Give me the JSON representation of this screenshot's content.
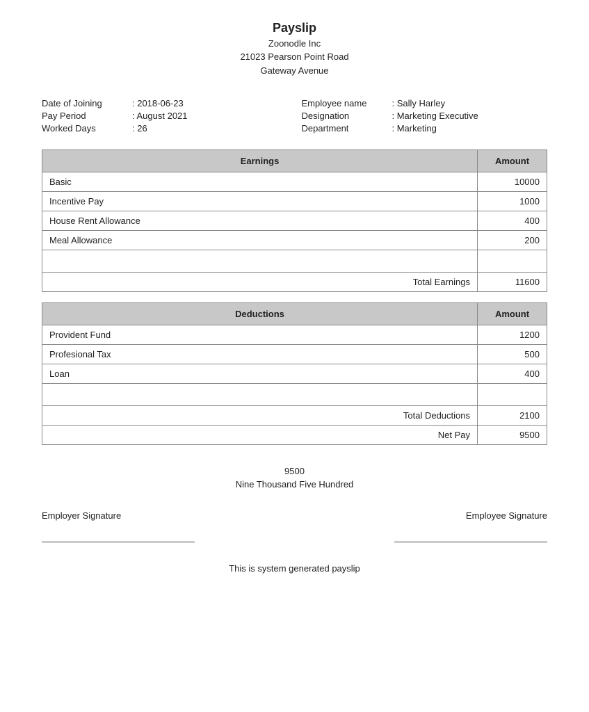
{
  "header": {
    "title": "Payslip",
    "company": "Zoonodle Inc",
    "address_line1": "21023 Pearson Point Road",
    "address_line2": "Gateway Avenue"
  },
  "employee_info": {
    "left": [
      {
        "label": "Date of Joining",
        "colon": ": 2018-06-23"
      },
      {
        "label": "Pay Period",
        "colon": ": August 2021"
      },
      {
        "label": "Worked Days",
        "colon": ": 26"
      }
    ],
    "right": [
      {
        "label": "Employee name",
        "colon": ": Sally Harley"
      },
      {
        "label": "Designation",
        "colon": ": Marketing Executive"
      },
      {
        "label": "Department",
        "colon": ": Marketing"
      }
    ]
  },
  "earnings": {
    "section_title": "Earnings",
    "amount_col": "Amount",
    "rows": [
      {
        "label": "Basic",
        "amount": "10000"
      },
      {
        "label": "Incentive Pay",
        "amount": "1000"
      },
      {
        "label": "House Rent Allowance",
        "amount": "400"
      },
      {
        "label": "Meal Allowance",
        "amount": "200"
      }
    ],
    "total_label": "Total Earnings",
    "total_amount": "11600"
  },
  "deductions": {
    "section_title": "Deductions",
    "amount_col": "Amount",
    "rows": [
      {
        "label": "Provident Fund",
        "amount": "1200"
      },
      {
        "label": "Profesional Tax",
        "amount": "500"
      },
      {
        "label": "Loan",
        "amount": "400"
      }
    ],
    "total_label": "Total Deductions",
    "total_amount": "2100",
    "net_pay_label": "Net Pay",
    "net_pay_amount": "9500"
  },
  "net_amount": {
    "number": "9500",
    "words": "Nine Thousand Five Hundred"
  },
  "signatures": {
    "employer": "Employer Signature",
    "employee": "Employee Signature"
  },
  "footer": {
    "text": "This is system generated payslip"
  }
}
